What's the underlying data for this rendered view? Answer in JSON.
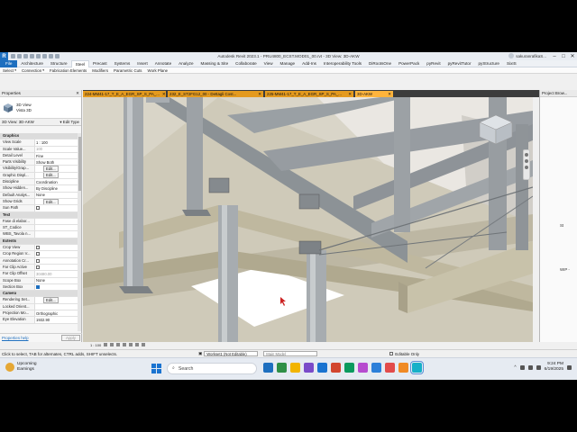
{
  "window": {
    "app_badge": "R",
    "title": "Autodesk Revit 2023.1 - PRU4800_ECST.MOD01_00.rvt - 3D View: 3D-AKW",
    "user": "sakuranrafikaS..."
  },
  "ribbon_tabs": [
    "File",
    "Architecture",
    "Structure",
    "Steel",
    "Precast",
    "Systems",
    "Insert",
    "Annotate",
    "Analyze",
    "Massing & Site",
    "Collaborate",
    "View",
    "Manage",
    "Add-Ins",
    "Interoperability Tools",
    "DiRootsOne",
    "PowerPack",
    "pyRevit",
    "pyRevitTutor",
    "pyStructure",
    "SixIS"
  ],
  "active_tab": "Steel",
  "ribbon_panel": {
    "items": [
      "Select",
      "Connection",
      "Fabrication Elements",
      "Modifiers",
      "Parametric Cuts",
      "Work Plane"
    ],
    "dropdowns": [
      true,
      true,
      false,
      false,
      false,
      false
    ]
  },
  "doc_tabs": [
    {
      "label": "224-MM41-17_T_E_A_EGR_SP_S_PA_...",
      "active": false
    },
    {
      "label": "232_E_ST2FG12_00 - Dettagli Cost...",
      "active": false
    },
    {
      "label": "225-MM41-17_T_E_A_EGR_SP_S_PA_...",
      "active": false
    },
    {
      "label": "3D-AKW",
      "active": true
    }
  ],
  "properties": {
    "header": "Properties",
    "type_line1": "3D View",
    "type_line2": "Vista 3D",
    "selector": "3D View: 3D-AKW",
    "edit_type": "Edit Type",
    "rows": [
      {
        "k": "Graphics",
        "section": true
      },
      {
        "k": "View Scale",
        "v": "1 : 100"
      },
      {
        "k": "Scale Value...",
        "v": "100",
        "grey": true
      },
      {
        "k": "Detail Level",
        "v": "Fine"
      },
      {
        "k": "Parts Visibility",
        "v": "Show Both"
      },
      {
        "k": "Visibility/Grap...",
        "v": "",
        "btn": "Edit..."
      },
      {
        "k": "Graphic Displ...",
        "v": "",
        "btn": "Edit..."
      },
      {
        "k": "Discipline",
        "v": "Coordination"
      },
      {
        "k": "Show Hidden...",
        "v": "By Discipline"
      },
      {
        "k": "Default Analys...",
        "v": "None"
      },
      {
        "k": "Show Grids",
        "v": "",
        "btn": "Edit..."
      },
      {
        "k": "Sun Path",
        "v": "",
        "check": false
      },
      {
        "k": "Text",
        "section": true
      },
      {
        "k": "Fase di elabor...",
        "v": ""
      },
      {
        "k": "ST_Codice",
        "v": ""
      },
      {
        "k": "WBS_Tavola n...",
        "v": ""
      },
      {
        "k": "Extents",
        "section": true
      },
      {
        "k": "Crop View",
        "v": "",
        "check": false
      },
      {
        "k": "Crop Region V...",
        "v": "",
        "check": false
      },
      {
        "k": "Annotation Cr...",
        "v": "",
        "check": false
      },
      {
        "k": "Far Clip Active",
        "v": "",
        "check": false
      },
      {
        "k": "Far Clip Offset",
        "v": "30480.00",
        "grey": true
      },
      {
        "k": "Scope Box",
        "v": "None"
      },
      {
        "k": "Section Box",
        "v": "",
        "check": true
      },
      {
        "k": "Camera",
        "section": true
      },
      {
        "k": "Rendering Set...",
        "v": "",
        "btn": "Edit..."
      },
      {
        "k": "Locked Orient...",
        "v": "",
        "grey": true
      },
      {
        "k": "Projection Mo...",
        "v": "Orthographic"
      },
      {
        "k": "Eye Elevation",
        "v": "1932.90"
      }
    ],
    "help_link": "Properties help",
    "apply": "Apply"
  },
  "view_control": {
    "scale": "1 : 100"
  },
  "project_browser": {
    "header": "Project Brow...",
    "tree": [
      "",
      "",
      "",
      "",
      "",
      "",
      "",
      "",
      "",
      "",
      "",
      "",
      "",
      "",
      "",
      "",
      "",
      "",
      "",
      "",
      "St",
      "",
      "",
      "",
      "",
      "",
      "",
      "WIP -",
      "",
      ""
    ]
  },
  "status": {
    "message": "Click to select, TAB for alternates, CTRL adds, SHIFT unselects.",
    "workset": "Workset1 (Not Editable)",
    "model": "Main Model",
    "editable_only": "Editable Only"
  },
  "taskbar": {
    "weather_title": "Upcoming",
    "weather_sub": "Earnings",
    "search": "Search",
    "time": "9:24 PM",
    "date": "6/19/2025",
    "app_colors": [
      "#1e6fbf",
      "#2f8f46",
      "#f2b400",
      "#7a4bc9",
      "#1a73d0",
      "#d2462f",
      "#0a9a5e",
      "#b64bcf",
      "#2c7fd9",
      "#e24b4b",
      "#f08a24",
      "#16b0c8"
    ]
  }
}
